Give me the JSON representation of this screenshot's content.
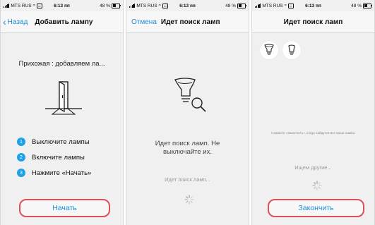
{
  "status_bar": {
    "carrier": "MTS RUS",
    "time": "6:13 пп",
    "battery": "48 %"
  },
  "screen1": {
    "nav_back": "Назад",
    "title": "Добавить лампу",
    "subtitle": "Прихожая : добавляем ла...",
    "steps": [
      {
        "num": "1",
        "label": "Выключите лампы"
      },
      {
        "num": "2",
        "label": "Включите лампы"
      },
      {
        "num": "3",
        "label": "Нажмите «Начать»"
      }
    ],
    "button": "Начать"
  },
  "screen2": {
    "nav_cancel": "Отмена",
    "title": "Идет поиск ламп",
    "message": "Идет поиск ламп. Не выключайте их.",
    "status": "Идет поиск ламп..."
  },
  "screen3": {
    "title": "Идет поиск ламп",
    "note": "Нажмите «Закончить», когда найдутся все ваши лампы",
    "status": "Ищем другие...",
    "button": "Закончить"
  },
  "colors": {
    "accent": "#1a8fd8",
    "step_badge": "#1ea1e8",
    "highlight": "#e0505c"
  },
  "icons": [
    "signal-icon",
    "wifi-icon",
    "battery-icon",
    "back-chevron-icon",
    "door-icon",
    "bulb-search-icon",
    "spinner-icon",
    "bulb-icon"
  ]
}
